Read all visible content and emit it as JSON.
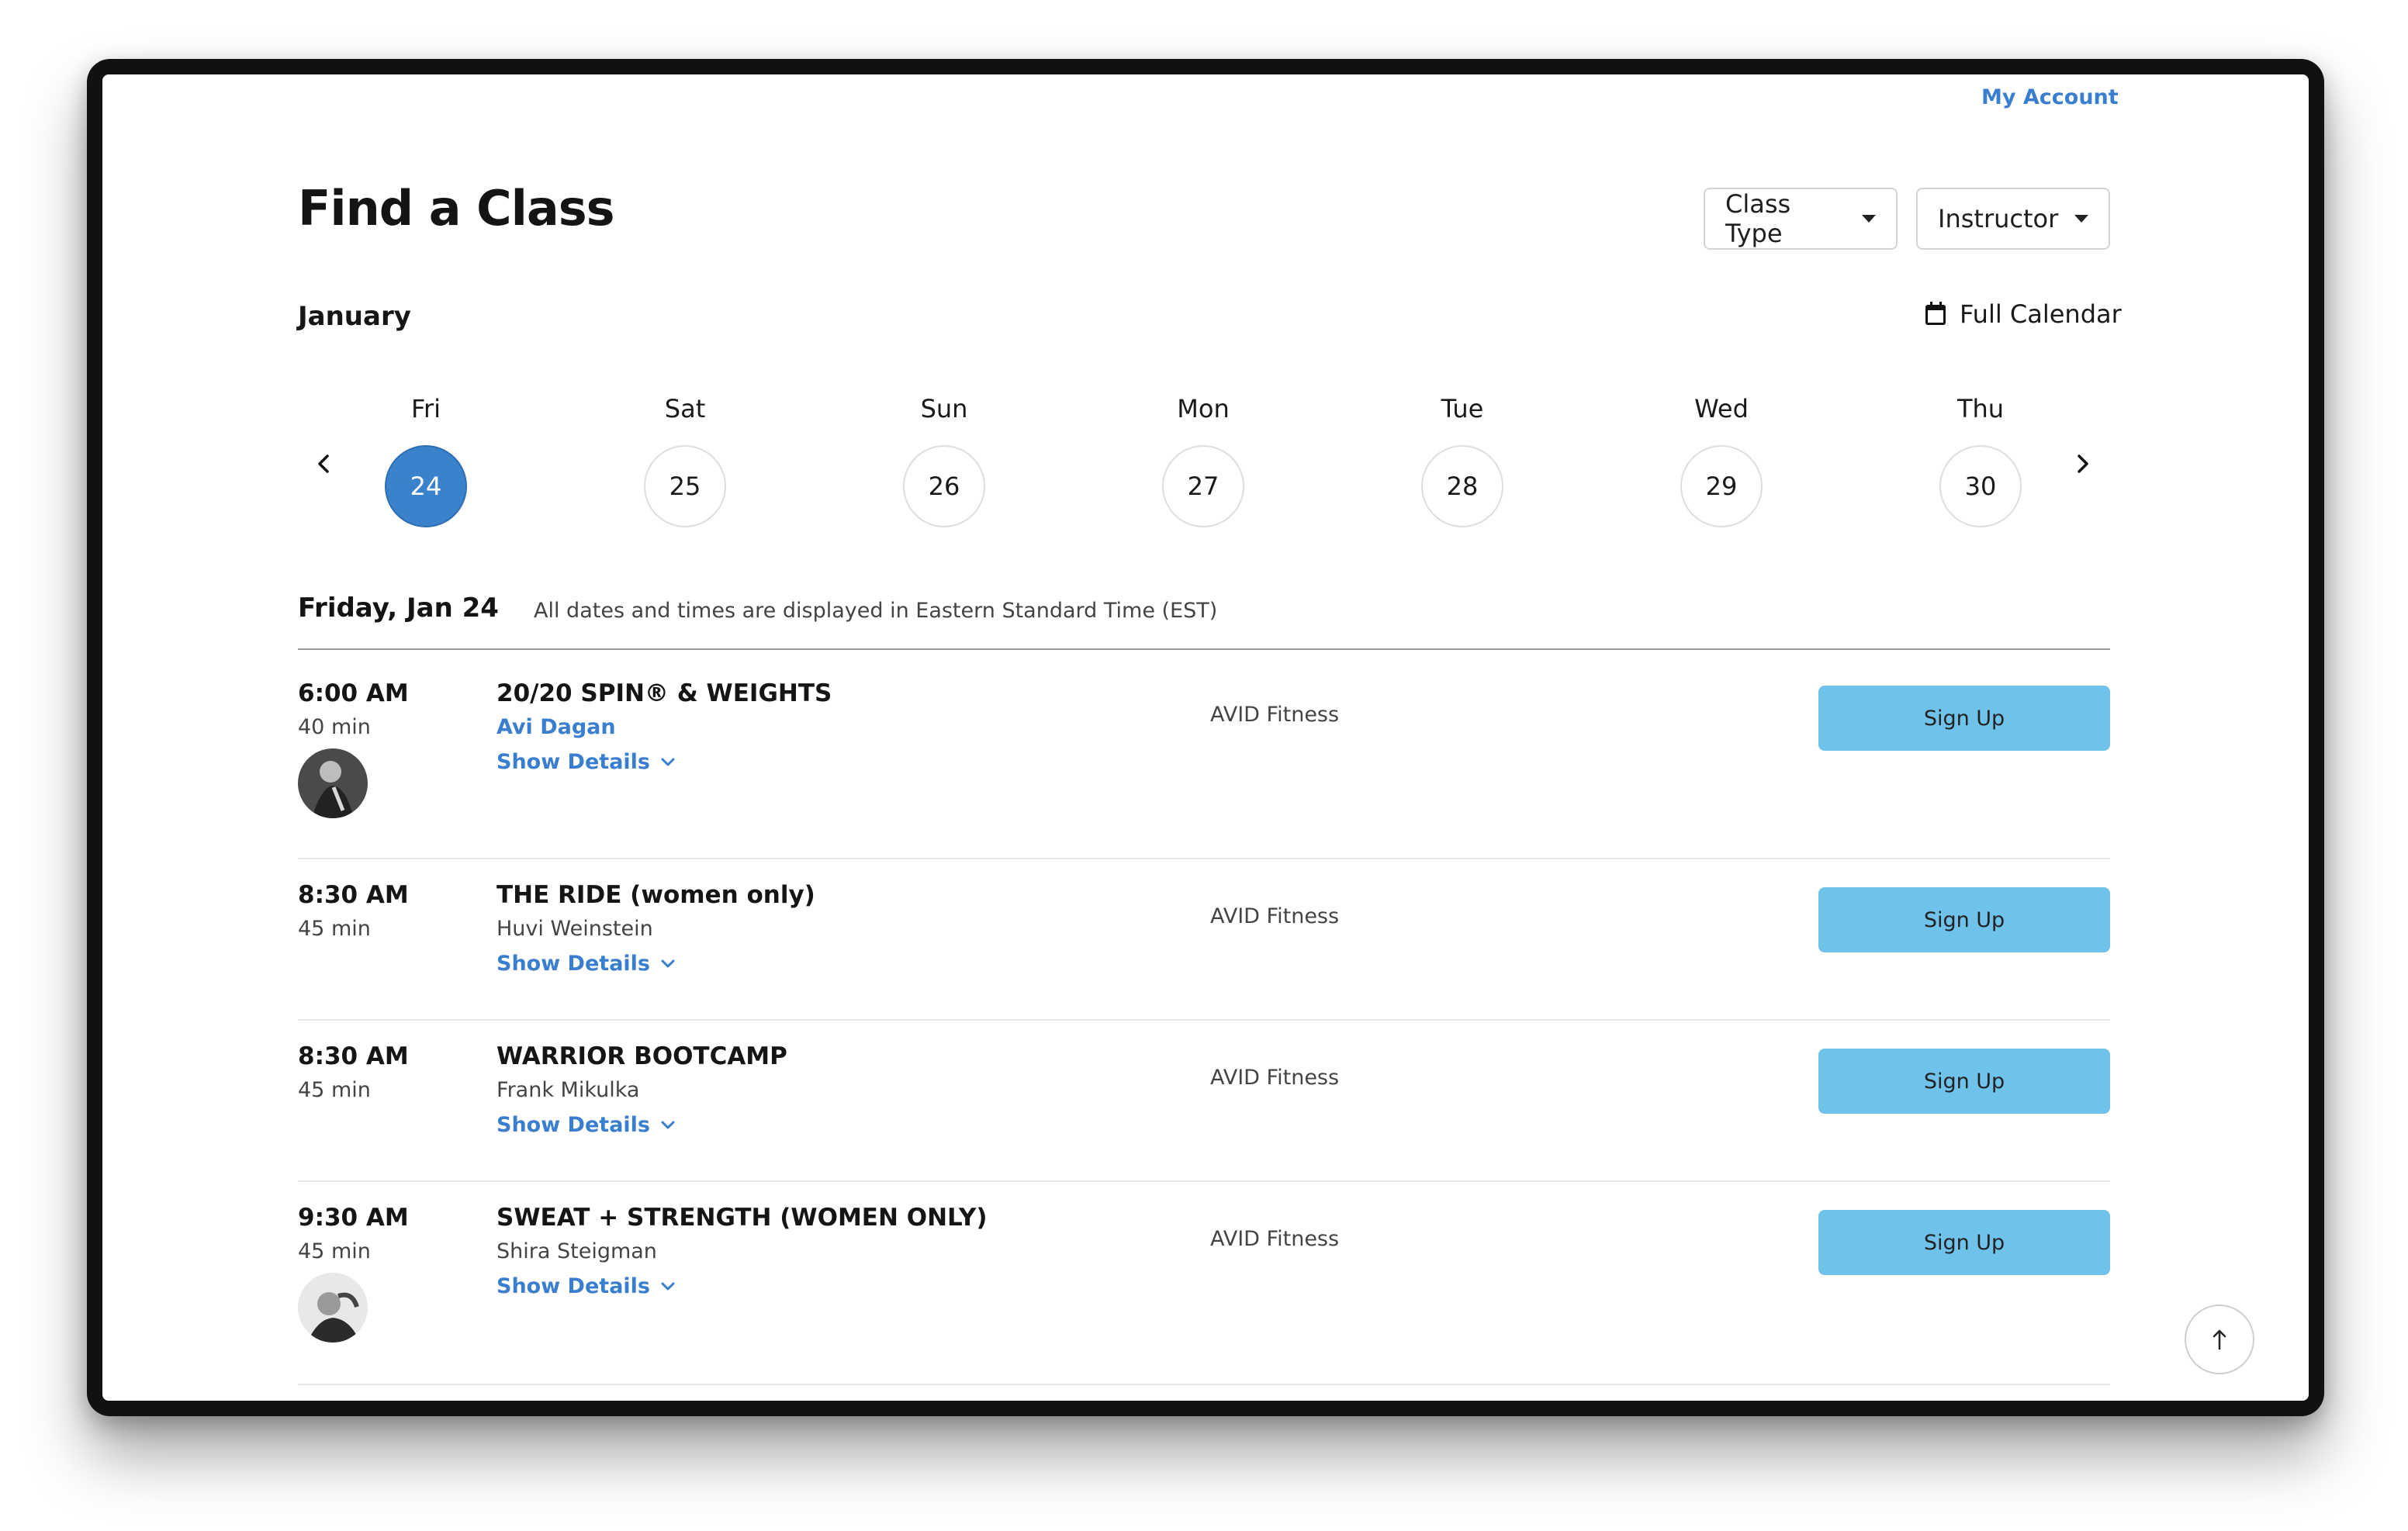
{
  "header": {
    "account_label": "My Account",
    "title": "Find a Class"
  },
  "filters": {
    "class_type": "Class Type",
    "instructor": "Instructor"
  },
  "calendar": {
    "month": "January",
    "full_calendar_label": "Full Calendar",
    "days": [
      {
        "name": "Fri",
        "num": "24",
        "active": true
      },
      {
        "name": "Sat",
        "num": "25"
      },
      {
        "name": "Sun",
        "num": "26"
      },
      {
        "name": "Mon",
        "num": "27"
      },
      {
        "name": "Tue",
        "num": "28"
      },
      {
        "name": "Wed",
        "num": "29"
      },
      {
        "name": "Thu",
        "num": "30"
      }
    ]
  },
  "schedule": {
    "date_heading": "Friday, Jan 24",
    "timezone_note": "All dates and times are displayed in Eastern Standard Time (EST)",
    "show_details_label": "Show Details",
    "signup_label": "Sign Up",
    "classes": [
      {
        "time": "6:00 AM",
        "duration": "40 min",
        "name": "20/20 SPIN® & WEIGHTS",
        "instructor": "Avi Dagan",
        "studio": "AVID Fitness"
      },
      {
        "time": "8:30 AM",
        "duration": "45 min",
        "name": "THE RIDE (women only)",
        "instructor": "Huvi Weinstein",
        "studio": "AVID Fitness"
      },
      {
        "time": "8:30 AM",
        "duration": "45 min",
        "name": "WARRIOR BOOTCAMP",
        "instructor": "Frank Mikulka",
        "studio": "AVID Fitness"
      },
      {
        "time": "9:30 AM",
        "duration": "45 min",
        "name": "SWEAT + STRENGTH (WOMEN ONLY)",
        "instructor": "Shira Steigman",
        "studio": "AVID Fitness"
      }
    ]
  },
  "colors": {
    "accent": "#3a82cc",
    "signup_bg": "#6fc2ea",
    "link": "#3a7fcf"
  }
}
